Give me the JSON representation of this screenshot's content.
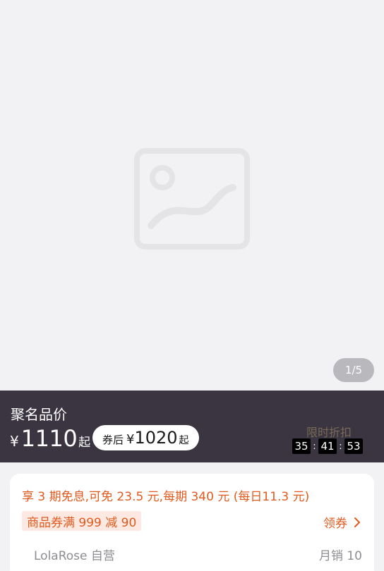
{
  "gallery": {
    "image_icon": "image-placeholder-icon",
    "page_indicator": "1/5"
  },
  "price_banner": {
    "label": "聚名品价",
    "currency": "¥",
    "price": "1110",
    "price_suffix": "起",
    "coupon_label": "券后",
    "coupon_currency": "¥",
    "coupon_price": "1020",
    "coupon_suffix": "起",
    "flash_sale_label": "限时折扣",
    "countdown": [
      "35",
      "41",
      "53"
    ],
    "countdown_separator": ":"
  },
  "info_card": {
    "installment": "享 3 期免息,可免 23.5 元,每期 340 元 (每日11.3 元)",
    "coupon_tag": "商品券满 999 减 90",
    "get_coupon": "领券",
    "shop_name": "LolaRose 自营",
    "monthly_sales": "月销 10"
  },
  "colors": {
    "banner_bg": "#3a3541",
    "accent_orange": "#e05a1e",
    "coupon_tag_bg": "#fde9e1",
    "flash_label": "#7a6a56"
  }
}
